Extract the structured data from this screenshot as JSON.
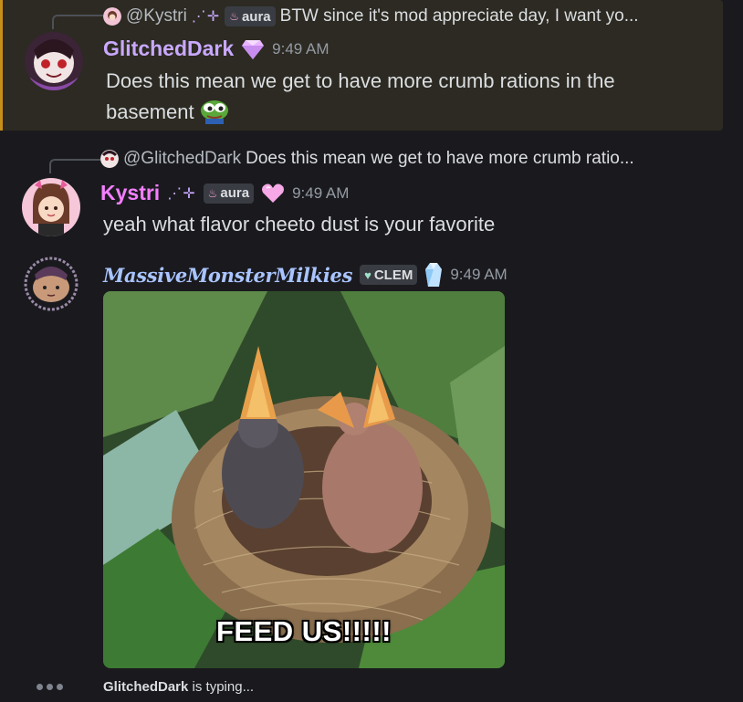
{
  "messages": [
    {
      "reply": {
        "name": "@Kystri",
        "decoration": "⋰✛",
        "badge": "aura",
        "text": "BTW since it's mod appreciate day, I want yo..."
      },
      "author": "GlitchedDark",
      "author_color": "#c9a8ff",
      "role_icon": "gem-icon",
      "time": "9:49 AM",
      "text": "Does this mean we get to have more crumb rations in the basement",
      "emoji": "pepe-emoji"
    },
    {
      "reply": {
        "name": "@GlitchedDark",
        "text": "Does this mean we get to have more crumb ratio..."
      },
      "author": "Kystri",
      "author_color": "#f47fff",
      "decoration": "⋰✛",
      "badge": "aura",
      "role_icon": "heart-icon",
      "time": "9:49 AM",
      "text": "yeah what flavor cheeto dust is your favorite"
    },
    {
      "author": "MassiveMonsterMilkies",
      "author_color": "#a9c4ff",
      "badge": "CLEM",
      "role_icon": "crystal-icon",
      "time": "9:49 AM",
      "gif_caption": "FEED US!!!!!"
    }
  ],
  "typing": {
    "user": "GlitchedDark",
    "suffix": " is typing..."
  },
  "colors": {
    "background": "#1a1a1e",
    "highlight_bg": "#2c2a22",
    "highlight_border": "#c98e1a"
  }
}
